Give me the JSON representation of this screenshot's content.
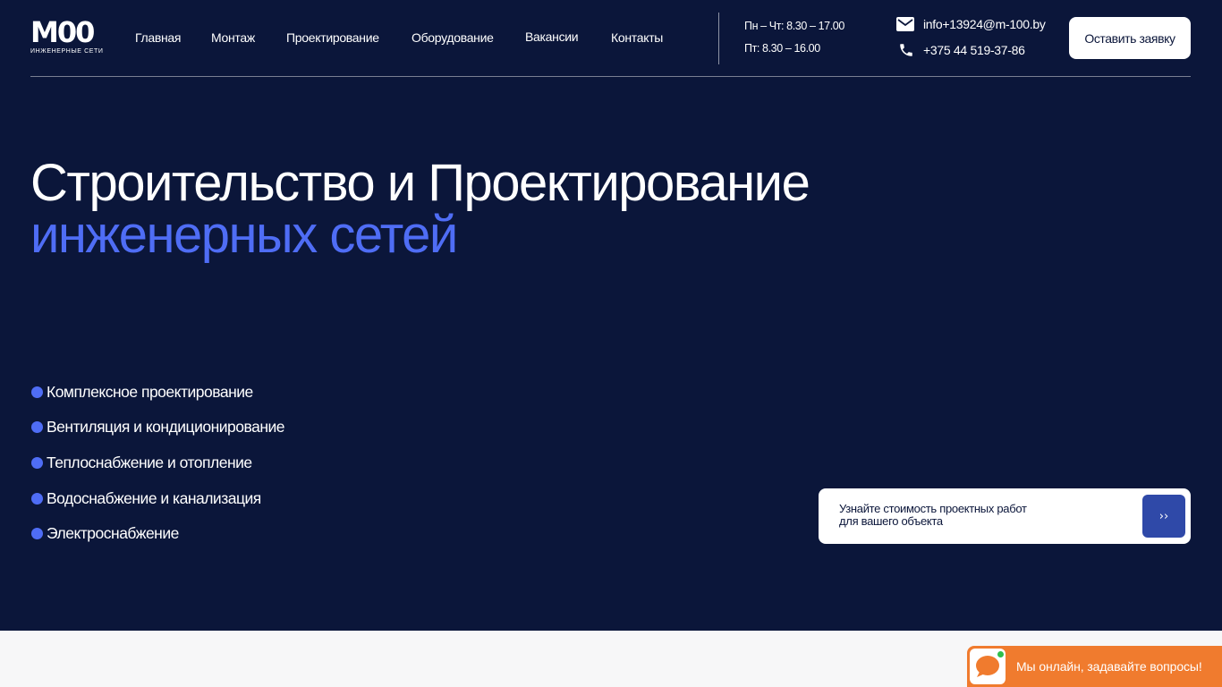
{
  "header": {
    "logo_mark": "M00",
    "logo_sub": "ИНЖЕНЕРНЫЕ СЕТИ",
    "nav": [
      {
        "label": "Главная"
      },
      {
        "label": "Монтаж"
      },
      {
        "label": "Проектирование"
      },
      {
        "label": "Оборудование"
      },
      {
        "label": "Вакансии"
      },
      {
        "label": "Контакты"
      }
    ],
    "hours": {
      "weekdays": "Пн – Чт: 8.30 – 17.00",
      "friday": "Пт: 8.30 – 16.00"
    },
    "email": "info+13924@m-100.by",
    "phone": "+375 44 519-37-86",
    "cta_label": "Оставить заявку"
  },
  "hero": {
    "headline_line1": "Строительство и Проектирование",
    "headline_line2": "инженерных сетей",
    "services": [
      "Комплексное проектирование",
      "Вентиляция и кондиционирование",
      "Теплоснабжение и отопление",
      "Водоснабжение и канализация",
      "Электроснабжение"
    ],
    "quote_card": {
      "line1": "Узнайте стоимость проектных работ",
      "line2": "для вашего объекта",
      "button_label": "››"
    }
  },
  "chat_widget": {
    "text": "Мы онлайн, задавайте вопросы!"
  },
  "icons": {
    "email": "mail-icon",
    "phone": "phone-icon",
    "chat": "chat-bubble-icon"
  },
  "colors": {
    "background": "#0b163a",
    "accent": "#4f6df5",
    "button_dark": "#2f49a8",
    "chat": "#f07b2e",
    "online": "#2fbf4a"
  }
}
